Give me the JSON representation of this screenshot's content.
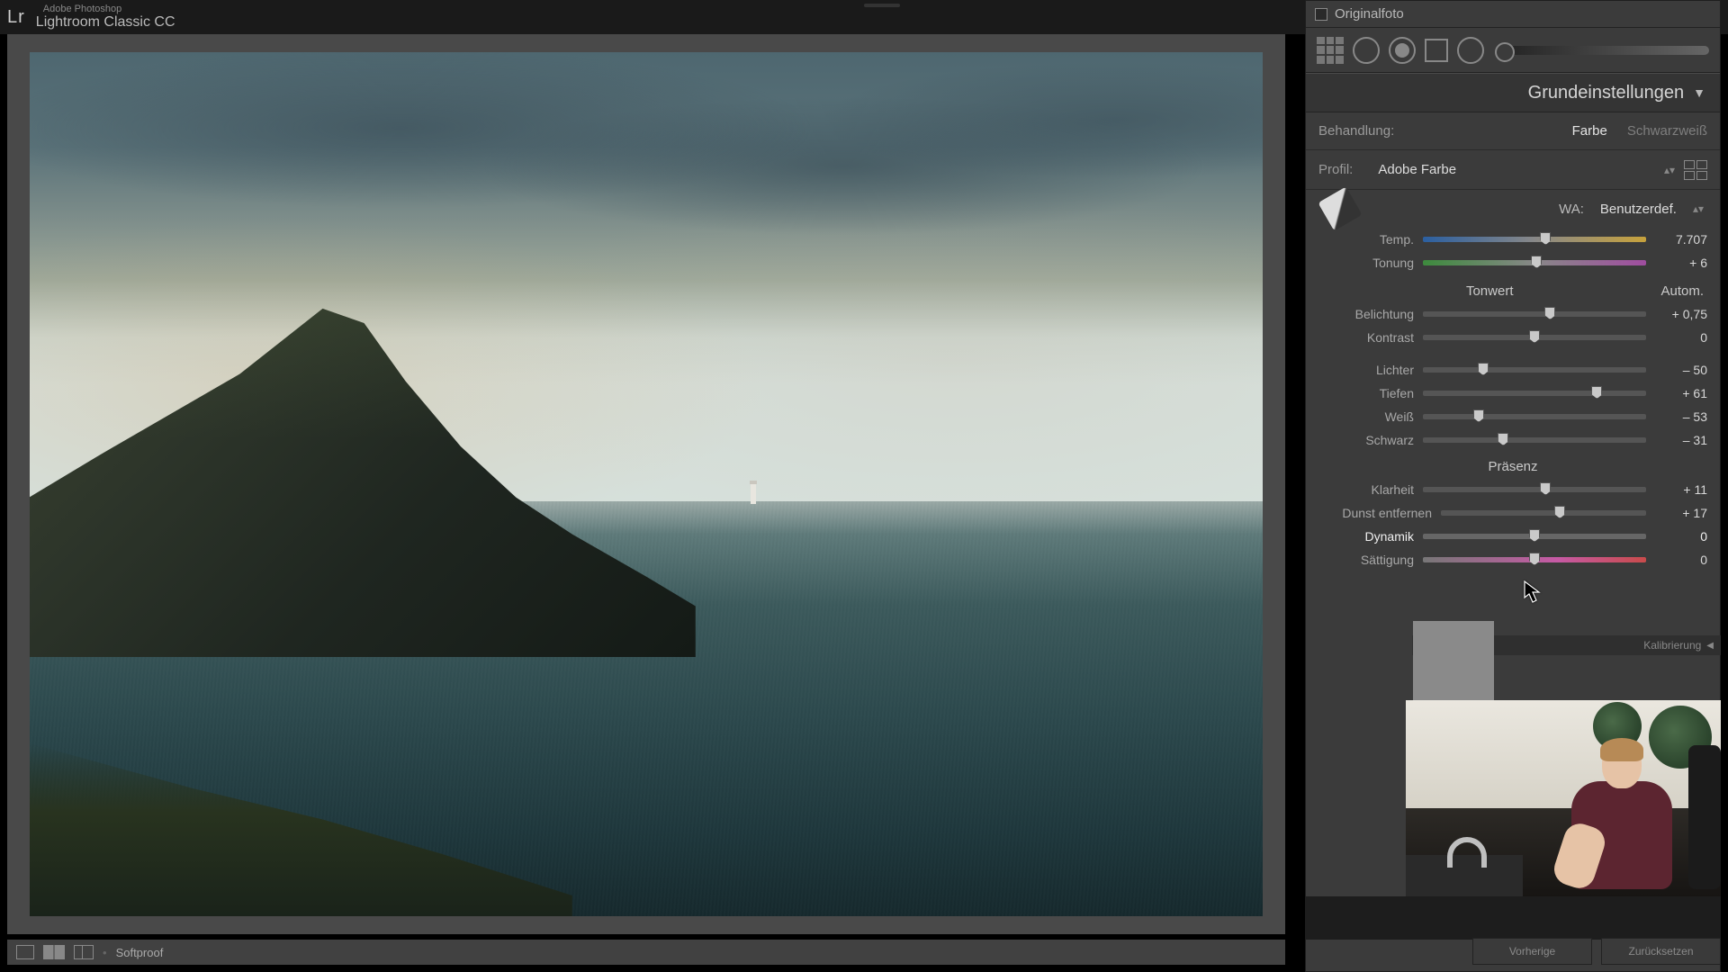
{
  "app": {
    "logo": "Lr",
    "name_small": "Adobe Photoshop",
    "name": "Lightroom Classic CC"
  },
  "original_checkbox_label": "Originalfoto",
  "panel": {
    "title": "Grundeinstellungen",
    "treatment": {
      "label": "Behandlung:",
      "color": "Farbe",
      "bw": "Schwarzweiß"
    },
    "profile": {
      "label": "Profil:",
      "value": "Adobe Farbe"
    },
    "wb": {
      "label": "WA:",
      "mode": "Benutzerdef."
    },
    "temp": {
      "label": "Temp.",
      "value": "7.707",
      "pos": 55
    },
    "tint": {
      "label": "Tonung",
      "value": "+ 6",
      "pos": 51
    },
    "tone_head": "Tonwert",
    "tone_auto": "Autom.",
    "exposure": {
      "label": "Belichtung",
      "value": "+ 0,75",
      "pos": 57
    },
    "contrast": {
      "label": "Kontrast",
      "value": "0",
      "pos": 50
    },
    "highlights": {
      "label": "Lichter",
      "value": "– 50",
      "pos": 27
    },
    "shadows": {
      "label": "Tiefen",
      "value": "+ 61",
      "pos": 78
    },
    "whites": {
      "label": "Weiß",
      "value": "– 53",
      "pos": 25
    },
    "blacks": {
      "label": "Schwarz",
      "value": "– 31",
      "pos": 36
    },
    "presence_head": "Präsenz",
    "clarity": {
      "label": "Klarheit",
      "value": "+ 11",
      "pos": 55
    },
    "dehaze": {
      "label": "Dunst entfernen",
      "value": "+ 17",
      "pos": 58
    },
    "vibrance": {
      "label": "Dynamik",
      "value": "0",
      "pos": 50
    },
    "saturation": {
      "label": "Sättigung",
      "value": "0",
      "pos": 50
    }
  },
  "calibration_label": "Kalibrierung",
  "statusbar": {
    "softproof": "Softproof"
  },
  "buttons": {
    "previous": "Vorherige",
    "reset": "Zurücksetzen"
  }
}
